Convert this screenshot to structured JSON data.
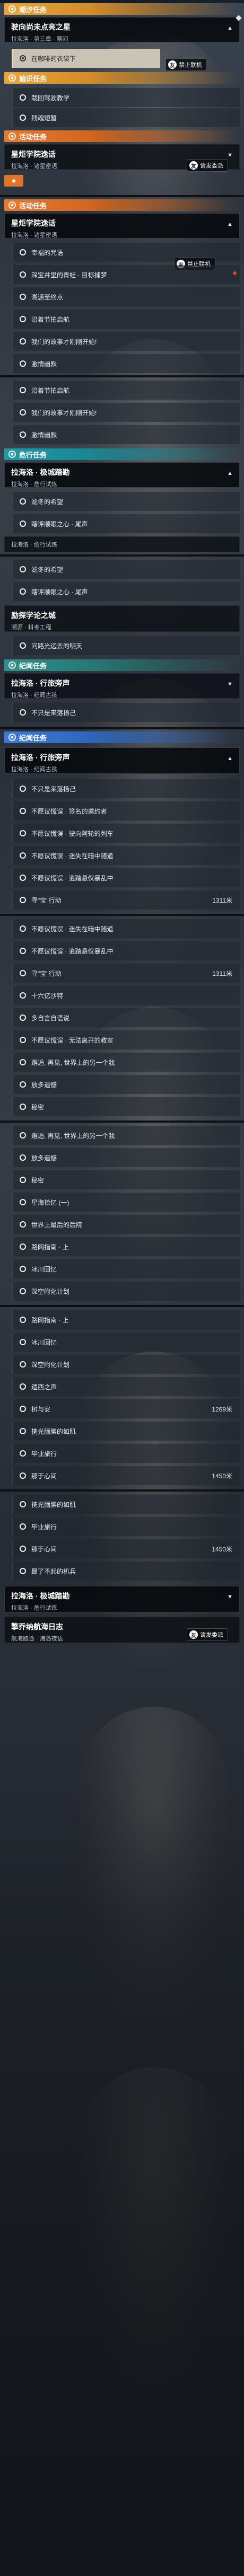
{
  "categories": {
    "main": "潮汐任务",
    "spread": "遍识任务",
    "activity": "活动任务",
    "danger": "危行任务",
    "memoir": "纪闻任务"
  },
  "badges": {
    "friend_forbid": "禁止联机",
    "requested": "请发委派",
    "friend_icon": "友"
  },
  "panel1": {
    "quest_title": "驶向尚未点亮之星",
    "quest_sub": "拉海洛 · 第三章 · 幕间",
    "step1": "在咖啡的衣袋下",
    "spread_items": [
      "栽回驾驶教学",
      "残魂短暂"
    ],
    "activity_title": "星炬学院逸话",
    "activity_sub": "拉海洛 · 诸星密语"
  },
  "panel2": {
    "activity_title": "星炬学院逸话",
    "activity_sub": "拉海洛 · 诸星密语",
    "items_a": [
      "幸福的咒语",
      "深宝井里的青蛙 · 目标捕梦",
      "溯源至终点",
      "沿着节拍启航",
      "我们的故事才刚刚开始!",
      "激情幽默"
    ],
    "items_b": [
      "沿着节拍启航",
      "我们的故事才刚刚开始!",
      "激情幽默"
    ],
    "danger_title": "拉海洛 · 极城踏勘",
    "danger_sub": "拉海洛 · 危行试炼",
    "danger_items": [
      "滤冬的希望",
      "瞎评顺眼之心 · 尾声"
    ],
    "cut_title": "拉海洛 · 危行试炼"
  },
  "panel3": {
    "items": [
      "滤冬的希望",
      "瞎评顺眼之心 · 尾声"
    ],
    "spread_title": "励探学论之城",
    "spread_sub": "溯源 · 科考工程",
    "spread_items": [
      "问路光远去的明天"
    ],
    "memoir_title": "拉海洛 · 行旅旁声",
    "memoir_sub": "拉海洛 · 纪闻古孩",
    "memoir_items": [
      "不只是来落扬己"
    ]
  },
  "panel4": {
    "memoir_title": "拉海洛 · 行旅旁声",
    "memoir_sub": "拉海洛 · 纪闻古孩",
    "items": [
      {
        "label": "不只是来落扬己",
        "num": ""
      },
      {
        "label": "不愿议慌误 · 签名的邀约者",
        "num": ""
      },
      {
        "label": "不愿议慌误 · 驶向阿轮的列车",
        "num": ""
      },
      {
        "label": "不愿议慌误 · 迷失在暗中随道",
        "num": ""
      },
      {
        "label": "不愿议慌误 · 逍踏悬仪暴乱中",
        "num": ""
      },
      {
        "label": "寻\"宝\"行动",
        "num": "1311米"
      }
    ]
  },
  "panel5": {
    "items": [
      {
        "label": "不愿议慌误 · 迷失在暗中随道",
        "num": ""
      },
      {
        "label": "不愿议慌误 · 逍踏悬仪暴乱中",
        "num": ""
      },
      {
        "label": "寻\"宝\"行动",
        "num": "1311米"
      },
      {
        "label": "十六亿沙特",
        "num": ""
      },
      {
        "label": "多自言自语说",
        "num": ""
      },
      {
        "label": "不愿议慌误 · 无法离开的教室",
        "num": ""
      },
      {
        "label": "邂逅, 再见, 世界上的另一个我",
        "num": ""
      },
      {
        "label": "放多遥憾",
        "num": ""
      },
      {
        "label": "秘密",
        "num": ""
      }
    ]
  },
  "panel6": {
    "items": [
      {
        "label": "邂逅, 再见, 世界上的另一个我",
        "num": ""
      },
      {
        "label": "放多遥憾",
        "num": ""
      },
      {
        "label": "秘密",
        "num": ""
      },
      {
        "label": "星海拾忆 (一)",
        "num": ""
      },
      {
        "label": "世界上最后的后院",
        "num": ""
      },
      {
        "label": "路网指南 · 上",
        "num": ""
      },
      {
        "label": "冰川回忆",
        "num": ""
      },
      {
        "label": "深空附化计划",
        "num": ""
      }
    ]
  },
  "panel7": {
    "items": [
      {
        "label": "路网指南 · 上",
        "num": ""
      },
      {
        "label": "冰川回忆",
        "num": ""
      },
      {
        "label": "深空附化计划",
        "num": ""
      },
      {
        "label": "遗西之声",
        "num": ""
      },
      {
        "label": "树与安",
        "num": "1269米"
      },
      {
        "label": "携光腼腆的如肌",
        "num": ""
      },
      {
        "label": "毕业旅行",
        "num": ""
      },
      {
        "label": "那于心间",
        "num": "1450米"
      }
    ]
  },
  "panel8": {
    "items": [
      {
        "label": "携光腼腆的如肌",
        "num": ""
      },
      {
        "label": "毕业旅行",
        "num": ""
      },
      {
        "label": "那于心间",
        "num": "1450米"
      },
      {
        "label": "最了不起的机兵",
        "num": ""
      }
    ],
    "danger_title": "拉海洛 · 极城踏勘",
    "danger_sub": "拉海洛 · 危行试炼",
    "last_title": "擎乔纳航海日志",
    "last_sub": "航海路途 · 海岛夜语"
  }
}
